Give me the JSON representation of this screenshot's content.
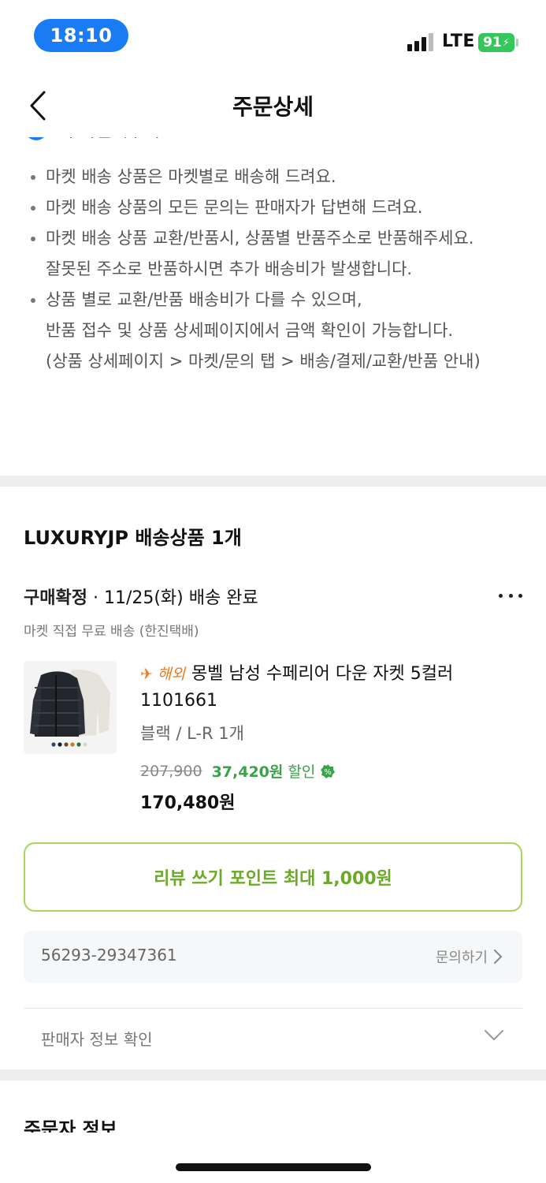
{
  "status_bar": {
    "time": "18:10",
    "network": "LTE",
    "battery": "91"
  },
  "header": {
    "title": "주문상세"
  },
  "notice": {
    "cut_text": "꼭 확인해주세요.",
    "items": [
      "마켓 배송 상품은 마켓별로 배송해 드려요.",
      "마켓 배송 상품의 모든 문의는 판매자가 답변해 드려요.",
      "마켓 배송 상품 교환/반품시, 상품별 반품주소로 반품해주세요.\n잘못된 주소로 반품하시면 추가 배송비가 발생합니다.",
      "상품 별로 교환/반품 배송비가 다를 수 있으며,\n반품 접수 및 상품 상세페이지에서 금액 확인이 가능합니다.\n(상품 상세페이지 > 마켓/문의 탭 > 배송/결제/교환/반품 안내)"
    ]
  },
  "seller_section": {
    "title": "LUXURYJP 배송상품 1개",
    "status_confirmed": "구매확정",
    "status_detail": " · 11/25(화) 배송 완료",
    "shipping_method": "마켓 직접 무료 배송 (한진택배)",
    "product": {
      "overseas_tag": "해외",
      "name": "몽벨 남성 수페리어 다운 자켓 5컬러 1101661",
      "option": "블랙 / L-R  1개",
      "original_price": "207,900",
      "discount_amount": "37,420원",
      "discount_label": "할인",
      "final_price": "170,480원"
    },
    "review_button": "리뷰 쓰기 포인트 최대 1,000원",
    "order_number": "56293-29347361",
    "inquiry_label": "문의하기",
    "seller_info_label": "판매자 정보 확인"
  },
  "orderer": {
    "title": "주문자 정보"
  },
  "colors": {
    "accent_blue": "#1a7cf5",
    "discount_green": "#3aa34a",
    "review_green": "#6aaa26",
    "overseas_orange": "#f07a1a"
  }
}
